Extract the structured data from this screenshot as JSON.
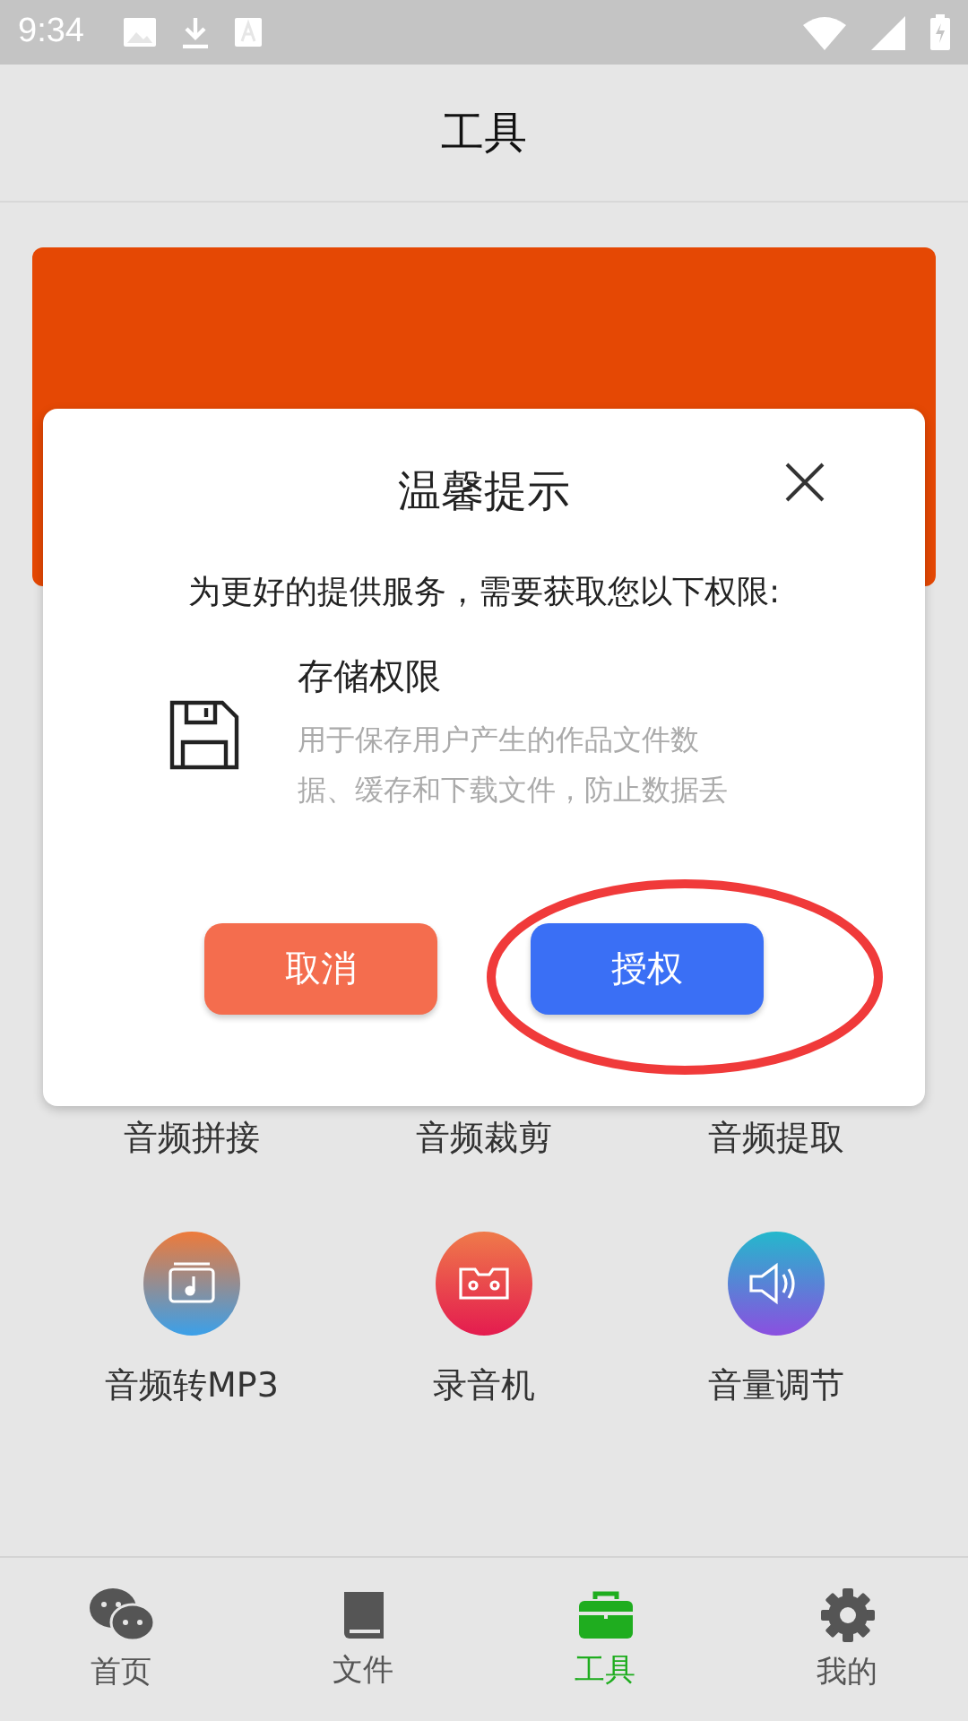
{
  "status_bar": {
    "time": "9:34"
  },
  "header": {
    "title": "工具"
  },
  "banner": {
    "kind": "promo"
  },
  "tools": [
    {
      "label": "音频拼接"
    },
    {
      "label": "音频裁剪"
    },
    {
      "label": "音频提取"
    },
    {
      "label": "音频转MP3",
      "kind": "music"
    },
    {
      "label": "录音机",
      "kind": "cassette"
    },
    {
      "label": "音量调节",
      "kind": "volume"
    }
  ],
  "dialog": {
    "title": "温馨提示",
    "intro": "为更好的提供服务，需要获取您以下权限:",
    "permissions": [
      {
        "title": "存储权限",
        "description": "用于保存用户产生的作品文件数据、缓存和下载文件，防止数据丢"
      }
    ],
    "buttons": [
      {
        "label": "取消",
        "kind": "cancel"
      },
      {
        "label": "授权",
        "kind": "confirm",
        "circled": true
      }
    ]
  },
  "nav": [
    {
      "label": "首页",
      "kind": "chat",
      "selected": false
    },
    {
      "label": "文件",
      "kind": "book",
      "selected": false
    },
    {
      "label": "工具",
      "kind": "toolbox",
      "selected": true
    },
    {
      "label": "我的",
      "kind": "gear",
      "selected": false
    }
  ]
}
